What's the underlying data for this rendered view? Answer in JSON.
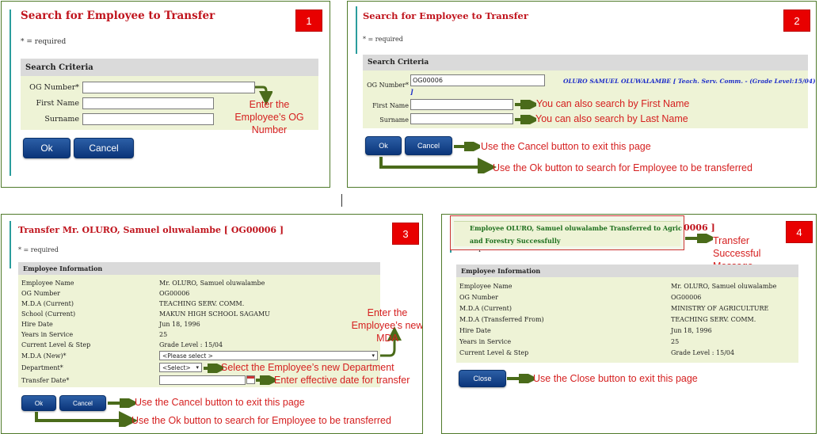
{
  "p1": {
    "title": "Search for Employee to Transfer",
    "badge": "1",
    "required": "* = required",
    "criteria_header": "Search Criteria",
    "og_label": "OG Number*",
    "first_label": "First Name",
    "surname_label": "Surname",
    "ok": "Ok",
    "cancel": "Cancel",
    "note_og": "Enter the Employee’s OG Number"
  },
  "p2": {
    "title": "Search for Employee to Transfer",
    "badge": "2",
    "required": "* = required",
    "criteria_header": "Search Criteria",
    "og_label": "OG Number*",
    "og_value": "OG00006",
    "result_text": "OLURO SAMUEL OLUWALAMBE [ Teach. Serv. Comm. - (Grade Level:15/04)",
    "result_bracket": "]",
    "first_label": "First Name",
    "surname_label": "Surname",
    "ok": "Ok",
    "cancel": "Cancel",
    "note_first": "You can also search by First Name",
    "note_last": "You can also search by Last Name",
    "note_cancel": "Use the Cancel button to exit this page",
    "note_ok": "Use the Ok button to search for Employee to be transferred"
  },
  "p3": {
    "title": "Transfer Mr. OLURO, Samuel oluwalambe [ OG00006 ]",
    "badge": "3",
    "required": "* = required",
    "info_header": "Employee Information",
    "rows": [
      {
        "label": "Employee Name",
        "value": "Mr. OLURO, Samuel oluwalambe"
      },
      {
        "label": "OG Number",
        "value": "OG00006"
      },
      {
        "label": "M.D.A (Current)",
        "value": "TEACHING SERV. COMM."
      },
      {
        "label": "School (Current)",
        "value": "MAKUN HIGH SCHOOL SAGAMU"
      },
      {
        "label": "Hire Date",
        "value": "Jun 18, 1996"
      },
      {
        "label": "Years in Service",
        "value": "25"
      },
      {
        "label": "Current Level & Step",
        "value": "Grade Level : 15/04"
      }
    ],
    "mda_new_label": "M.D.A (New)*",
    "mda_new_value": "<Please select >",
    "dept_label": "Department*",
    "dept_value": "<Select>",
    "transfer_label": "Transfer Date*",
    "ok": "Ok",
    "cancel": "Cancel",
    "note_mda": "Enter the Employee’s new MDA",
    "note_dept": "Select the Employee’s new Department",
    "note_date": "Enter effective date for transfer",
    "note_cancel": "Use the Cancel button to exit this page",
    "note_ok": "Use the Ok button to search for Employee to be transferred"
  },
  "p4": {
    "badge": "4",
    "success_msg": "Employee OLURO, Samuel oluwalambe Transferred to Agric and Forestry Successfully",
    "title_tail": "0006 ]",
    "required_partial": "= required",
    "info_header": "Employee Information",
    "rows": [
      {
        "label": "Employee Name",
        "value": "Mr. OLURO, Samuel oluwalambe"
      },
      {
        "label": "OG Number",
        "value": "OG00006"
      },
      {
        "label": "M.D.A (Current)",
        "value": "MINISTRY OF AGRICULTURE"
      },
      {
        "label": "M.D.A (Transferred From)",
        "value": "TEACHING SERV. COMM."
      },
      {
        "label": "Hire Date",
        "value": "Jun 18, 1996"
      },
      {
        "label": "Years in Service",
        "value": "25"
      },
      {
        "label": "Current Level & Step",
        "value": "Grade Level : 15/04"
      }
    ],
    "close": "Close",
    "note_success": "Transfer Successful Message",
    "note_close": "Use the Close button to exit this page"
  },
  "colors": {
    "title_red": "#c0141d",
    "note_red": "#d51f1f",
    "button_blue": "#0b357a",
    "badge_red": "#e80000",
    "arrow_green": "#4a6b1a",
    "form_bg": "#eef3d6"
  },
  "icons": [
    "arrow-right-icon",
    "calendar-icon",
    "chevron-down-icon"
  ]
}
